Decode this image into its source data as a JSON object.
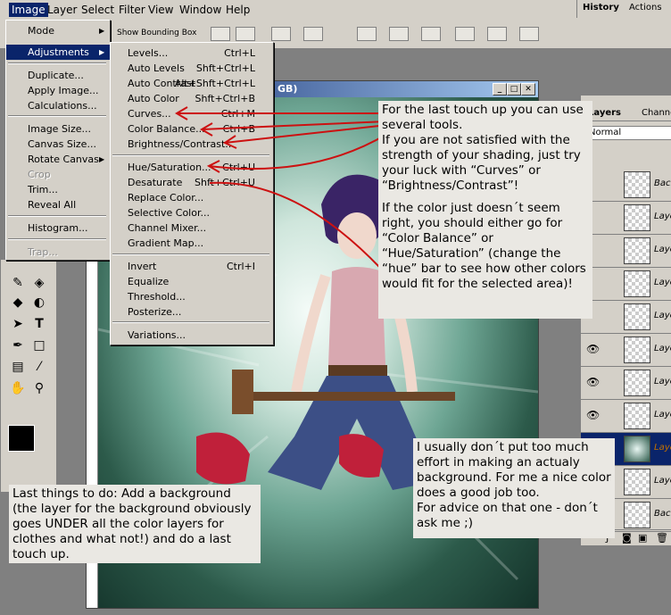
{
  "menubar": {
    "items": [
      "Image",
      "Layer",
      "Select",
      "Filter",
      "View",
      "Window",
      "Help"
    ],
    "active": "Image"
  },
  "options_bar": {
    "show_bounding_box": "Show Bounding Box"
  },
  "palette_tabs": [
    "History",
    "Actions"
  ],
  "document": {
    "title_fragment": "GB)"
  },
  "image_menu": {
    "items": [
      {
        "label": "Mode",
        "submenu": true
      },
      {
        "label": "Adjustments",
        "submenu": true,
        "selected": true
      },
      {
        "label": "Duplicate..."
      },
      {
        "label": "Apply Image..."
      },
      {
        "label": "Calculations..."
      },
      {
        "label": "Image Size..."
      },
      {
        "label": "Canvas Size..."
      },
      {
        "label": "Rotate Canvas",
        "submenu": true
      },
      {
        "label": "Crop",
        "disabled": true
      },
      {
        "label": "Trim..."
      },
      {
        "label": "Reveal All"
      },
      {
        "label": "Histogram..."
      },
      {
        "label": "Trap...",
        "disabled": true
      }
    ]
  },
  "adjustments_menu": {
    "items": [
      {
        "label": "Levels...",
        "shortcut": "Ctrl+L"
      },
      {
        "label": "Auto Levels",
        "shortcut": "Shft+Ctrl+L"
      },
      {
        "label": "Auto Contrast",
        "shortcut": "Alt+Shft+Ctrl+L"
      },
      {
        "label": "Auto Color",
        "shortcut": "Shft+Ctrl+B"
      },
      {
        "label": "Curves...",
        "shortcut": "Ctrl+M"
      },
      {
        "label": "Color Balance...",
        "shortcut": "Ctrl+B"
      },
      {
        "label": "Brightness/Contrast...",
        "shortcut": ""
      },
      {
        "label": "Hue/Saturation...",
        "shortcut": "Ctrl+U"
      },
      {
        "label": "Desaturate",
        "shortcut": "Shft+Ctrl+U"
      },
      {
        "label": "Replace Color...",
        "shortcut": ""
      },
      {
        "label": "Selective Color...",
        "shortcut": ""
      },
      {
        "label": "Channel Mixer...",
        "shortcut": ""
      },
      {
        "label": "Gradient Map...",
        "shortcut": ""
      },
      {
        "label": "Invert",
        "shortcut": "Ctrl+I"
      },
      {
        "label": "Equalize",
        "shortcut": ""
      },
      {
        "label": "Threshold...",
        "shortcut": ""
      },
      {
        "label": "Posterize...",
        "shortcut": ""
      },
      {
        "label": "Variations...",
        "shortcut": ""
      }
    ]
  },
  "layers_panel": {
    "tabs": [
      "Layers",
      "Channel"
    ],
    "blend_mode": "Normal",
    "layers": [
      {
        "name": "Back",
        "visible": false
      },
      {
        "name": "Laye",
        "visible": false
      },
      {
        "name": "Laye",
        "visible": false
      },
      {
        "name": "Laye",
        "visible": false
      },
      {
        "name": "Laye",
        "visible": false
      },
      {
        "name": "Laye",
        "visible": true
      },
      {
        "name": "Laye",
        "visible": true
      },
      {
        "name": "Laye",
        "visible": true
      },
      {
        "name": "Laye",
        "visible": true,
        "selected": true
      },
      {
        "name": "Laye",
        "visible": false
      },
      {
        "name": "Back",
        "visible": false
      }
    ]
  },
  "notes": {
    "top_right": [
      "For the last touch up you can use several tools.\nIf you are not satisfied with the strength of your shading, just try your luck with “Curves” or “Brightness/Contrast”!",
      "If the color just doesn´t seem right, you should either go for “Color Balance” or “Hue/Saturation” (change the “hue” bar to see how other colors would fit for the selected area)!"
    ],
    "middle_right": "I usually don´t put too much effort in making an actualy background. For me a nice color does a good job too.\nFor advice on that one - don´t ask me ;)",
    "bottom_left": "Last things to do: Add a background (the layer for the background obviously goes UNDER all the color layers for clothes and what not!) and do a last touch up."
  },
  "colors": {
    "menu_bg": "#d4d0c8",
    "highlight": "#0a246a",
    "annotation_arrows": "#cc1111"
  }
}
